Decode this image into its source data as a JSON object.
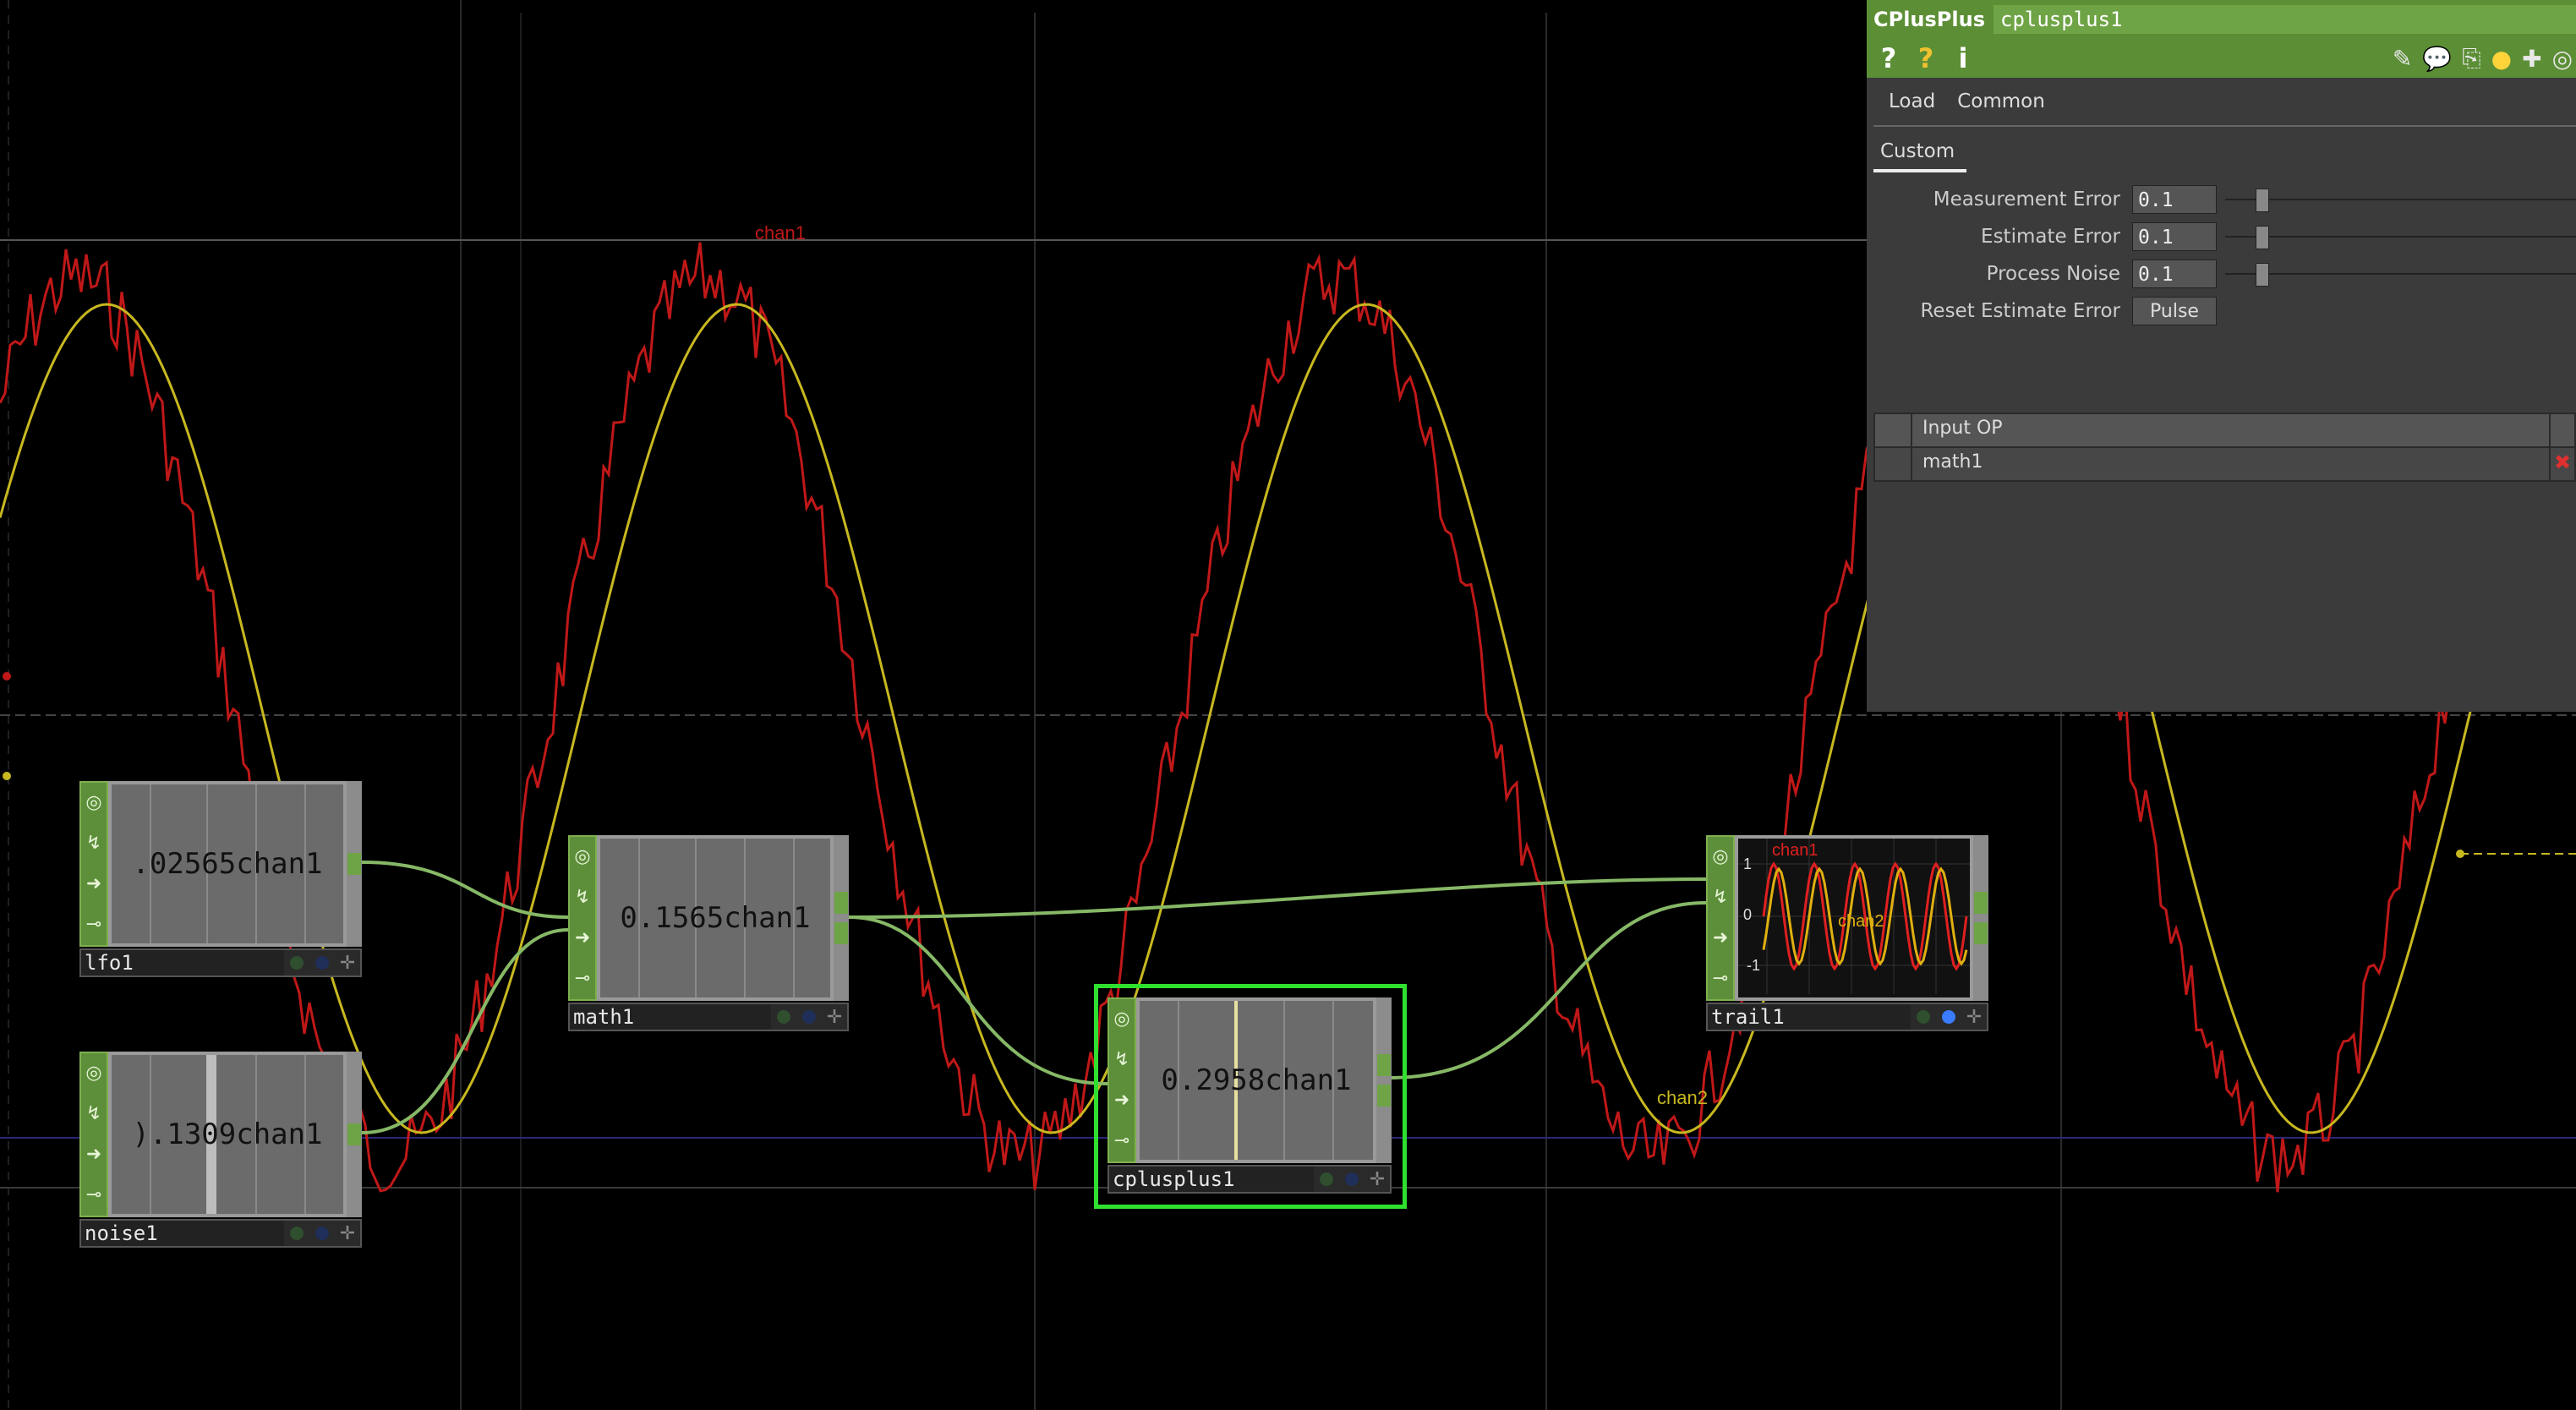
{
  "graph": {
    "labels": {
      "chan1": "chan1",
      "chan2": "chan2"
    },
    "colors": {
      "chan1": "#c01818",
      "chan2": "#c8b820",
      "wire": "#86b866",
      "accent": "#2fe02f"
    }
  },
  "nodes": {
    "lfo1": {
      "name": "lfo1",
      "value": ".02565",
      "channel": "chan1"
    },
    "noise1": {
      "name": "noise1",
      "value": ").1309",
      "channel": "chan1"
    },
    "math1": {
      "name": "math1",
      "value": "0.1565",
      "channel": "chan1"
    },
    "cplusplus1": {
      "name": "cplusplus1",
      "value": "0.2958",
      "channel": "chan1"
    },
    "trail1": {
      "name": "trail1",
      "chan1": "chan1",
      "chan2": "chan2",
      "tick_top": "1",
      "tick_mid": "0",
      "tick_bot": "-1"
    }
  },
  "node_icons": [
    "viewer-toggle-icon",
    "bypass-icon",
    "pass-through-icon",
    "lock-icon"
  ],
  "panel": {
    "op_type": "CPlusPlus",
    "op_name": "cplusplus1",
    "tool_icons": {
      "help": "?",
      "python_help": "?",
      "info": "i"
    },
    "tabs_row1": [
      "Load",
      "Common"
    ],
    "active_tab": "Custom",
    "params": [
      {
        "label": "Measurement Error",
        "value": "0.1"
      },
      {
        "label": "Estimate Error",
        "value": "0.1"
      },
      {
        "label": "Process Noise",
        "value": "0.1"
      }
    ],
    "reset": {
      "label": "Reset Estimate Error",
      "button": "Pulse"
    },
    "sequence": {
      "header": "Input OP",
      "rows": [
        "math1"
      ],
      "remove_glyph": "✖"
    }
  }
}
